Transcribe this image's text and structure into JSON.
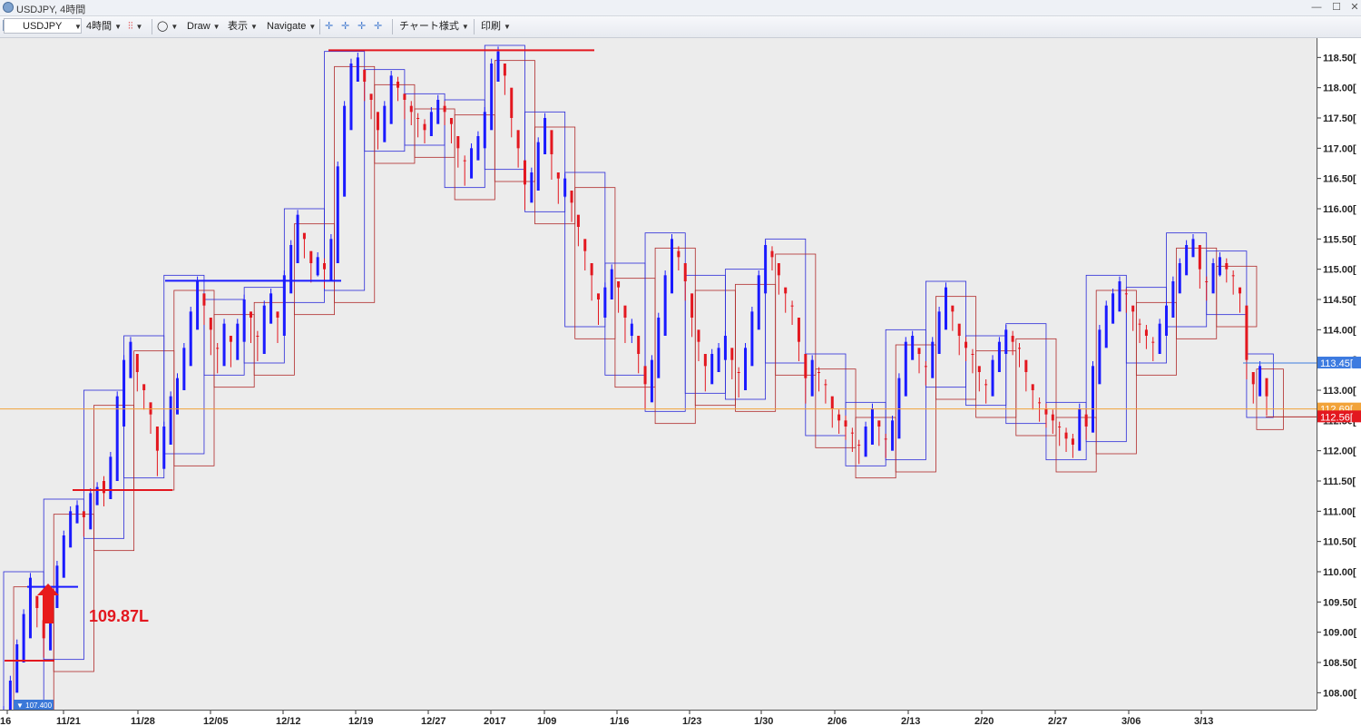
{
  "window": {
    "title": "USDJPY, 4時間"
  },
  "toolbar": {
    "symbol": "USDJPY",
    "timeframe": "4時間",
    "draw": "Draw",
    "view": "表示",
    "navigate": "Navigate",
    "chart_style": "チャート様式",
    "print": "印刷"
  },
  "colors": {
    "up": "#1a1aff",
    "down": "#e3171f",
    "current_line": "#f2a33a",
    "background": "#ececec"
  },
  "chart_data": {
    "type": "candlestick",
    "symbol": "USDJPY",
    "timeframe": "4時間",
    "ylim": [
      107.72,
      118.82
    ],
    "yticks": [
      108.0,
      108.5,
      109.0,
      109.5,
      110.0,
      110.5,
      111.0,
      111.5,
      112.0,
      112.5,
      113.0,
      113.5,
      114.0,
      114.5,
      115.0,
      115.5,
      116.0,
      116.5,
      117.0,
      117.5,
      118.0,
      118.5
    ],
    "ytick_labels": [
      "108.00[",
      "108.50[",
      "109.00[",
      "109.50[",
      "110.00[",
      "110.50[",
      "111.00[",
      "111.50[",
      "112.00[",
      "112.50[",
      "113.00[",
      "113.50[",
      "114.00[",
      "114.50[",
      "115.00[",
      "115.50[",
      "116.00[",
      "116.50[",
      "117.00[",
      "117.50[",
      "118.00[",
      "118.50["
    ],
    "xticks": [
      "16",
      "11/21",
      "11/28",
      "12/05",
      "12/12",
      "12/19",
      "12/27",
      "2017",
      "1/09",
      "1/16",
      "1/23",
      "1/30",
      "2/06",
      "2/13",
      "2/20",
      "2/27",
      "3/06",
      "3/13"
    ],
    "price_badges": [
      {
        "label": "113.45[",
        "value": 113.45,
        "color": "#3d7be0"
      },
      {
        "label": "112.69[",
        "value": 112.69,
        "color": "#f2a33a"
      },
      {
        "label": "112.56[",
        "value": 112.56,
        "color": "#e3171f"
      }
    ],
    "current_price": 112.69,
    "low_marker": {
      "label": "107.400"
    },
    "annotation": {
      "label": "109.87L",
      "value": 109.87
    },
    "series": [
      {
        "name": "",
        "values": [
          107.4,
          108.0,
          108.5,
          108.9,
          109.6,
          109.2,
          108.7,
          109.4,
          109.9,
          110.4,
          110.8,
          111.0,
          110.7,
          111.1,
          111.3,
          111.2,
          111.5,
          112.4,
          113.2,
          113.6,
          113.1,
          112.8,
          112.4,
          111.7,
          112.1,
          112.6,
          113.0,
          113.4,
          114.0,
          114.6,
          114.2,
          113.7,
          113.4,
          113.9,
          113.5,
          113.8,
          114.3,
          113.9,
          113.6,
          114.1,
          114.3,
          113.9,
          114.6,
          115.1,
          115.6,
          115.3,
          114.9,
          115.0,
          114.8,
          115.1,
          116.2,
          117.3,
          118.1,
          118.3,
          117.9,
          117.6,
          117.1,
          117.4,
          118.0,
          117.9,
          117.6,
          117.5,
          117.3,
          117.2,
          117.4,
          117.6,
          117.5,
          117.2,
          116.8,
          116.5,
          116.8,
          117.0,
          117.3,
          118.1,
          118.4,
          118.0,
          117.3,
          116.8,
          116.1,
          116.3,
          116.9,
          117.3,
          116.6,
          116.2,
          116.3,
          115.9,
          115.5,
          115.1,
          114.6,
          114.2,
          114.5,
          114.8,
          114.4,
          113.9,
          113.9,
          113.4,
          112.8,
          113.2,
          113.9,
          114.6,
          115.2,
          115.1,
          114.6,
          114.0,
          113.6,
          113.1,
          113.3,
          113.5,
          113.7,
          113.3,
          113.0,
          113.4,
          114.0,
          114.6,
          115.2,
          115.1,
          114.7,
          114.4,
          114.2,
          113.6,
          112.9,
          113.3,
          113.1,
          112.9,
          112.5,
          112.4,
          112.3,
          112.1,
          111.9,
          112.1,
          112.5,
          112.2,
          112.0,
          112.2,
          112.9,
          113.5,
          113.7,
          113.4,
          113.2,
          113.6,
          114.0,
          114.4,
          114.1,
          113.7,
          113.6,
          113.4,
          113.1,
          112.9,
          113.3,
          113.6,
          113.8,
          113.7,
          113.5,
          113.1,
          112.8,
          112.6,
          112.5,
          112.4,
          112.2,
          112.1,
          112.0,
          112.4,
          112.3,
          113.1,
          113.7,
          114.1,
          114.3,
          114.6,
          114.4,
          114.1,
          113.9,
          113.8,
          113.6,
          113.9,
          114.2,
          114.6,
          114.9,
          115.2,
          115.4,
          114.8,
          114.6,
          114.9,
          115.0,
          114.9,
          114.7,
          114.4,
          113.3,
          112.9,
          113.2,
          112.7
        ]
      },
      {
        "name": "",
        "values": [
          107.7,
          108.2,
          108.8,
          109.3,
          109.9,
          109.4,
          108.9,
          109.6,
          110.1,
          110.6,
          111.0,
          111.1,
          110.9,
          111.3,
          111.4,
          111.5,
          111.9,
          112.9,
          113.5,
          113.8,
          113.3,
          113.0,
          112.6,
          112.0,
          112.4,
          112.9,
          113.2,
          113.7,
          114.3,
          114.8,
          114.4,
          114.0,
          113.7,
          114.1,
          113.8,
          114.1,
          114.5,
          114.2,
          113.9,
          114.4,
          114.6,
          114.2,
          114.9,
          115.4,
          115.9,
          115.5,
          115.1,
          115.2,
          115.1,
          115.5,
          116.7,
          117.7,
          118.4,
          118.5,
          118.1,
          117.8,
          117.3,
          117.7,
          118.2,
          118.1,
          117.8,
          117.7,
          117.5,
          117.4,
          117.6,
          117.8,
          117.7,
          117.4,
          117.0,
          116.8,
          117.0,
          117.2,
          117.6,
          118.4,
          118.6,
          118.2,
          117.5,
          117.0,
          116.4,
          116.6,
          117.1,
          117.5,
          116.9,
          116.5,
          116.5,
          116.1,
          115.7,
          115.3,
          114.9,
          114.5,
          114.7,
          115.0,
          114.7,
          114.2,
          114.1,
          113.6,
          113.1,
          113.5,
          114.2,
          114.9,
          115.5,
          115.3,
          114.8,
          114.2,
          113.8,
          113.4,
          113.6,
          113.7,
          113.9,
          113.5,
          113.3,
          113.7,
          114.3,
          114.9,
          115.4,
          115.3,
          114.9,
          114.6,
          114.4,
          113.8,
          113.2,
          113.5,
          113.3,
          113.1,
          112.7,
          112.6,
          112.5,
          112.3,
          112.1,
          112.4,
          112.7,
          112.4,
          112.2,
          112.5,
          113.2,
          113.8,
          113.9,
          113.6,
          113.4,
          113.8,
          114.3,
          114.7,
          114.3,
          113.9,
          113.8,
          113.6,
          113.3,
          113.1,
          113.5,
          113.8,
          114.0,
          113.9,
          113.7,
          113.3,
          113.0,
          112.8,
          112.7,
          112.6,
          112.4,
          112.3,
          112.2,
          112.7,
          112.6,
          113.4,
          114.0,
          114.4,
          114.6,
          114.8,
          114.6,
          114.3,
          114.1,
          114.0,
          113.8,
          114.1,
          114.4,
          114.8,
          115.1,
          115.4,
          115.5,
          115.0,
          114.8,
          115.1,
          115.2,
          115.1,
          114.9,
          114.6,
          113.5,
          113.1,
          113.4,
          112.9
        ]
      }
    ],
    "levels": [
      {
        "value": 118.62,
        "color": "red"
      },
      {
        "value": 114.81,
        "color": "blue"
      },
      {
        "value": 111.35,
        "color": "red"
      },
      {
        "value": 109.75,
        "color": "blue"
      },
      {
        "value": 108.53,
        "color": "red"
      }
    ]
  }
}
